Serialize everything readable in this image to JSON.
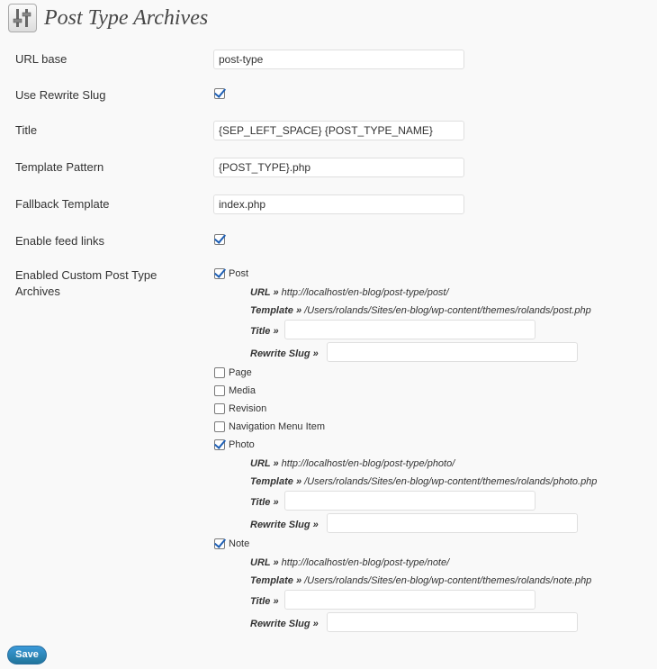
{
  "page": {
    "title": "Post Type Archives",
    "icon": "settings-sliders-icon"
  },
  "fields": {
    "url_base": {
      "label": "URL base",
      "value": "post-type"
    },
    "use_rewrite_slug": {
      "label": "Use Rewrite Slug",
      "checked": true
    },
    "title": {
      "label": "Title",
      "value": "{SEP_LEFT_SPACE} {POST_TYPE_NAME}"
    },
    "template_pattern": {
      "label": "Template Pattern",
      "value": "{POST_TYPE}.php"
    },
    "fallback_template": {
      "label": "Fallback Template",
      "value": "index.php"
    },
    "enable_feed_links": {
      "label": "Enable feed links",
      "checked": true
    },
    "enabled_archives": {
      "label_line1": "Enabled Custom Post Type",
      "label_line2": "Archives"
    }
  },
  "post_types": {
    "post": {
      "label": "Post",
      "checked": true,
      "url_label": "URL »",
      "url": "http://localhost/en-blog/post-type/post/",
      "template_label": "Template »",
      "template": "/Users/rolands/Sites/en-blog/wp-content/themes/rolands/post.php",
      "title_label": "Title »",
      "rewrite_label": "Rewrite Slug »"
    },
    "page": {
      "label": "Page",
      "checked": false
    },
    "media": {
      "label": "Media",
      "checked": false
    },
    "revision": {
      "label": "Revision",
      "checked": false
    },
    "nav_menu_item": {
      "label": "Navigation Menu Item",
      "checked": false
    },
    "photo": {
      "label": "Photo",
      "checked": true,
      "url_label": "URL »",
      "url": "http://localhost/en-blog/post-type/photo/",
      "template_label": "Template »",
      "template": "/Users/rolands/Sites/en-blog/wp-content/themes/rolands/photo.php",
      "title_label": "Title »",
      "rewrite_label": "Rewrite Slug »"
    },
    "note": {
      "label": "Note",
      "checked": true,
      "url_label": "URL »",
      "url": "http://localhost/en-blog/post-type/note/",
      "template_label": "Template »",
      "template": "/Users/rolands/Sites/en-blog/wp-content/themes/rolands/note.php",
      "title_label": "Title »",
      "rewrite_label": "Rewrite Slug »"
    }
  },
  "actions": {
    "save_label": "Save"
  },
  "colors": {
    "checkmark": "#1e5fb4",
    "button": "#21759b",
    "background": "#f9f9f9"
  }
}
